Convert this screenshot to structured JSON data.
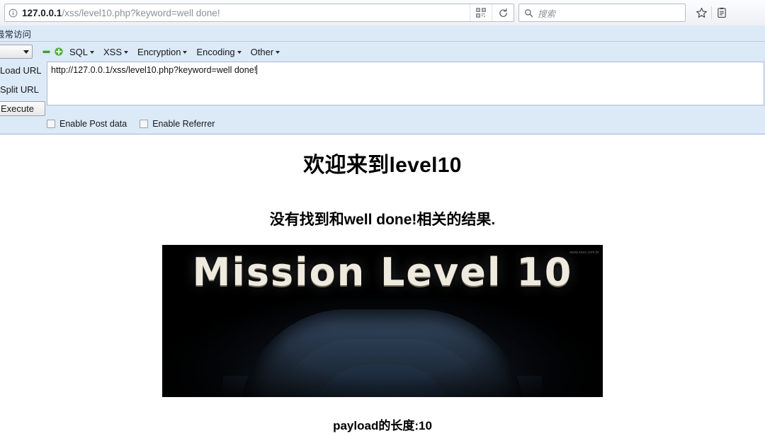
{
  "browser": {
    "url_display": {
      "host": "127.0.0.1",
      "path": "/xss/level10.php?keyword=well done!"
    },
    "identity_icon": "info-icon",
    "qr_icon": "qr-code-icon",
    "reload_icon": "reload-icon",
    "search": {
      "placeholder": "搜索",
      "value": "",
      "icon": "search-icon"
    },
    "bookmark_icon": "star-icon",
    "library_icon": "library-icon",
    "bookmarks_bar": {
      "most_visited_label": "最常访问"
    }
  },
  "hackbar": {
    "preset_select": {
      "value": "",
      "caret_icon": "chevron-down-icon"
    },
    "collapse_icon": "minus-icon",
    "expand_icon": "plus-icon",
    "menus": [
      {
        "label": "SQL"
      },
      {
        "label": "XSS"
      },
      {
        "label": "Encryption"
      },
      {
        "label": "Encoding"
      },
      {
        "label": "Other"
      }
    ],
    "buttons": {
      "load_url": "Load URL",
      "split_url": "Split URL",
      "execute": "Execute"
    },
    "url_textarea": {
      "value": "http://127.0.0.1/xss/level10.php?keyword=well done!"
    },
    "checkboxes": [
      {
        "label": "Enable Post data",
        "checked": false
      },
      {
        "label": "Enable Referrer",
        "checked": false
      }
    ]
  },
  "page": {
    "heading": "欢迎来到level10",
    "result_message": "没有找到和well done!相关的结果.",
    "banner": {
      "title_main": "Mission Level",
      "title_number": "10",
      "credit": "www.xxxx.com.br"
    },
    "payload_length": "payload的长度:10"
  },
  "colors": {
    "chrome_bg": "#f3f5f7",
    "hackbar_bg": "#dce9f7",
    "page_bg": "#ffffff",
    "banner_bg": "#000000",
    "accent_green": "#4caf3f"
  }
}
